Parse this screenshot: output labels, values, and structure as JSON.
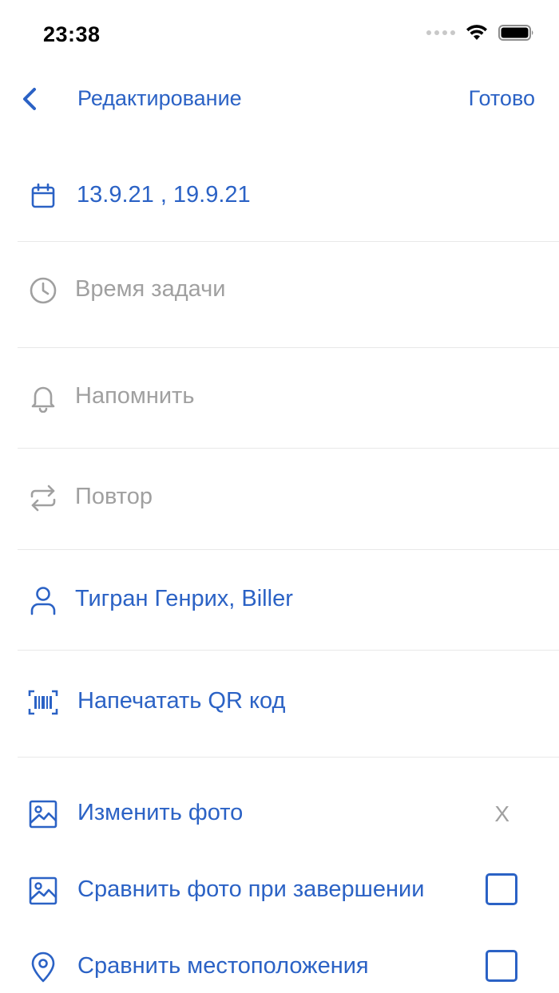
{
  "status_bar": {
    "time": "23:38"
  },
  "nav": {
    "title": "Редактирование",
    "done_label": "Готово"
  },
  "rows": {
    "date": {
      "label": "13.9.21 , 19.9.21"
    },
    "time": {
      "label": "Время задачи"
    },
    "remind": {
      "label": "Напомнить"
    },
    "repeat": {
      "label": "Повтор"
    },
    "assignees": {
      "label": "Тигран Генрих, Biller"
    },
    "qr": {
      "label": "Напечатать QR код"
    },
    "photo": {
      "label": "Изменить фото",
      "remove_label": "X"
    },
    "compare_photo": {
      "label": "Сравнить фото при завершении",
      "checked": false
    },
    "compare_location": {
      "label": "Сравнить местоположения",
      "checked": false
    }
  },
  "colors": {
    "accent": "#2b62c5",
    "muted": "#a0a0a0",
    "divider": "#e8e8e8"
  }
}
